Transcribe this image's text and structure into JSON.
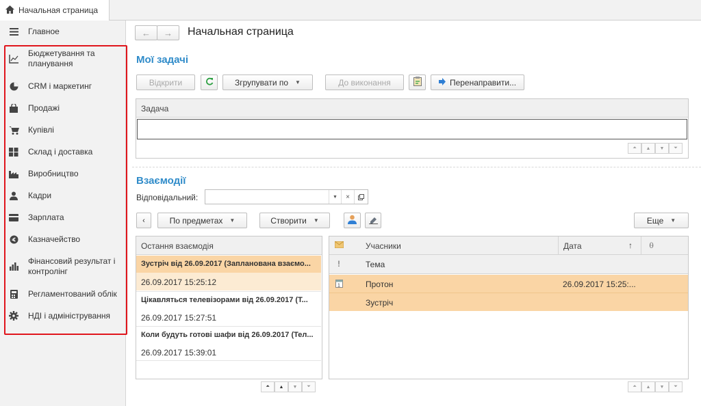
{
  "tab": {
    "label": "Начальная страница"
  },
  "sidebar": {
    "items": [
      {
        "label": "Главное",
        "icon": "menu-icon"
      },
      {
        "label": "Бюджетування та планування",
        "icon": "chart-axis-icon"
      },
      {
        "label": "CRM і маркетинг",
        "icon": "pie-icon"
      },
      {
        "label": "Продажі",
        "icon": "bag-icon"
      },
      {
        "label": "Купівлі",
        "icon": "cart-icon"
      },
      {
        "label": "Склад і доставка",
        "icon": "warehouse-icon"
      },
      {
        "label": "Виробництво",
        "icon": "factory-icon"
      },
      {
        "label": "Кадри",
        "icon": "person-icon"
      },
      {
        "label": "Зарплата",
        "icon": "card-icon"
      },
      {
        "label": "Казначейство",
        "icon": "coin-icon"
      },
      {
        "label": "Фінансовий результат і контролінг",
        "icon": "bar-chart-icon"
      },
      {
        "label": "Регламентований облік",
        "icon": "calculator-icon"
      },
      {
        "label": "НДІ і адміністрування",
        "icon": "gear-icon"
      }
    ],
    "highlight_color": "#e0141b"
  },
  "page": {
    "title": "Начальная страница"
  },
  "tasks": {
    "title": "Мої задачі",
    "open_label": "Відкрити",
    "group_label": "Згрупувати по",
    "todo_label": "До виконання",
    "redirect_label": "Перенаправити...",
    "column": "Задача"
  },
  "interactions": {
    "title": "Взаємодії",
    "responsible_label": "Відповідальний:",
    "responsible_value": "",
    "by_subjects_label": "По предметах",
    "create_label": "Створити",
    "more_label": "Еще",
    "left_column": "Остання взаємодія",
    "items": [
      {
        "title": "Зустріч від 26.09.2017 (Запланована взаємо...",
        "date": "26.09.2017 15:25:12"
      },
      {
        "title": "Цікавляться телевізорами від 26.09.2017 (Т...",
        "date": "26.09.2017 15:27:51"
      },
      {
        "title": "Коли будуть готові шафи від 26.09.2017 (Тел...",
        "date": "26.09.2017 15:39:01"
      }
    ],
    "right_columns": {
      "participants": "Учасники",
      "date": "Дата",
      "topic": "Тема"
    },
    "row": {
      "participants": "Протон",
      "date": "26.09.2017 15:25:...",
      "topic": "Зустріч"
    },
    "selection_color": "#fae0b8"
  }
}
